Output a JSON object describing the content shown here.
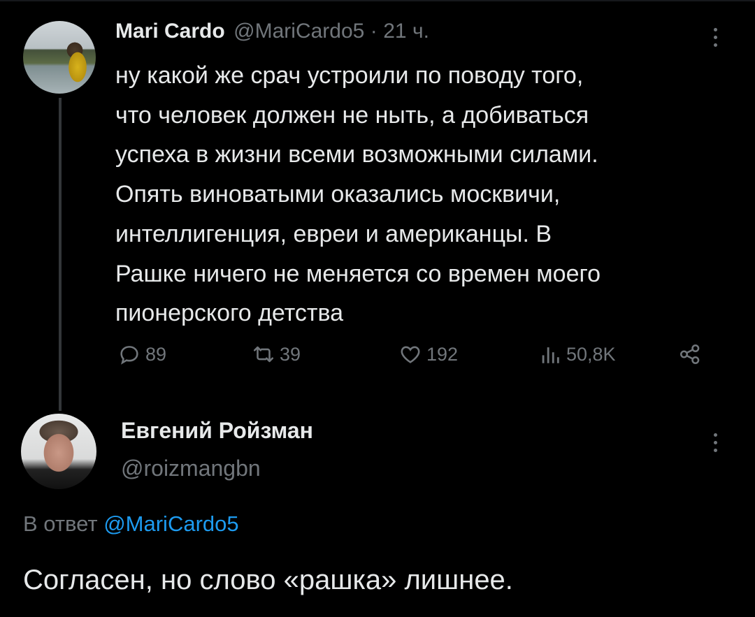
{
  "tweet": {
    "author_name": "Mari Cardo",
    "author_handle": "@MariCardo5",
    "time_sep": "·",
    "time": "21 ч.",
    "text_lines": [
      "ну какой же срач устроили по поводу того,",
      "что человек должен не ныть, а добиваться",
      "успеха в жизни всеми возможными силами.",
      "Опять виноватыми оказались москвичи,",
      "интеллигенция, евреи и американцы. В",
      "Рашке ничего не меняется со времен моего",
      "пионерского детства"
    ],
    "stats": {
      "replies": "89",
      "reposts": "39",
      "likes": "192",
      "views": "50,8K"
    }
  },
  "reply": {
    "author_name": "Евгений Ройзман",
    "author_handle": "@roizmangbn",
    "reply_prefix": "В ответ",
    "reply_mention": "@MariCardo5",
    "text": "Согласен, но слово «рашка» лишнее."
  },
  "icons": [
    "more-icon",
    "reply-icon",
    "repost-icon",
    "like-icon",
    "views-icon",
    "share-icon"
  ],
  "colors": {
    "background": "#000000",
    "text": "#e7e9ea",
    "secondary": "#71767b",
    "accent": "#1d9bf0"
  }
}
